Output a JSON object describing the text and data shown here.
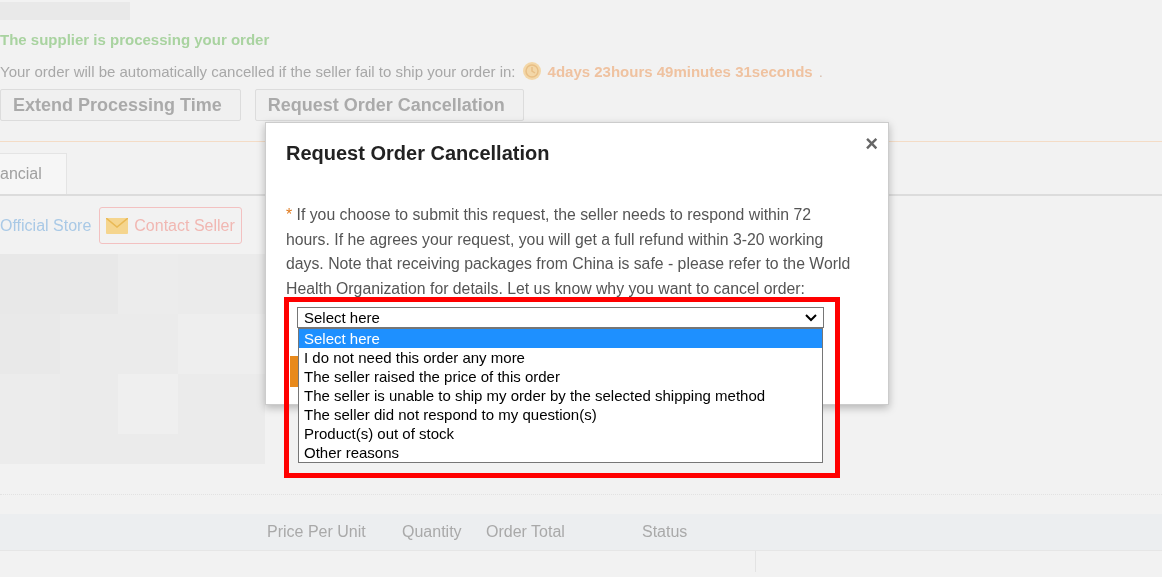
{
  "header": {
    "status": "The supplier is processing your order",
    "notice": "Your order will be automatically cancelled if the seller fail to ship your order in:",
    "countdown": "4days 23hours 49minutes 31seconds",
    "countdown_end": "."
  },
  "actions": [
    "Extend Processing Time",
    "Request Order Cancellation"
  ],
  "tabs": [
    {
      "label": "ancial",
      "selected": true
    }
  ],
  "store": {
    "name": "Official Store",
    "contact": "Contact Seller"
  },
  "table": {
    "columns": [
      "Price Per Unit",
      "Quantity",
      "Order Total",
      "Status"
    ]
  },
  "dialog": {
    "title": "Request Order Cancellation",
    "close": "×",
    "note_mark": "*",
    "note": "If you choose to submit this request, the seller needs to respond within 72 hours. If he agrees your request, you will get a full refund within 3-20 working days. Note that receiving packages from China is safe - please refer to the World Health Organization for details. Let us know why you want to cancel order:",
    "select": {
      "value": "Select here",
      "expanded": true,
      "highlighted": true,
      "options": [
        {
          "label": "Select here",
          "selected": true
        },
        {
          "label": "I do not need this order any more",
          "selected": false
        },
        {
          "label": "The seller raised the price of this order",
          "selected": false
        },
        {
          "label": "The seller is unable to ship my order by the selected shipping method",
          "selected": false
        },
        {
          "label": "The seller did not respond to my question(s)",
          "selected": false
        },
        {
          "label": "Product(s) out of stock",
          "selected": false
        },
        {
          "label": "Other reasons",
          "selected": false
        }
      ]
    }
  }
}
